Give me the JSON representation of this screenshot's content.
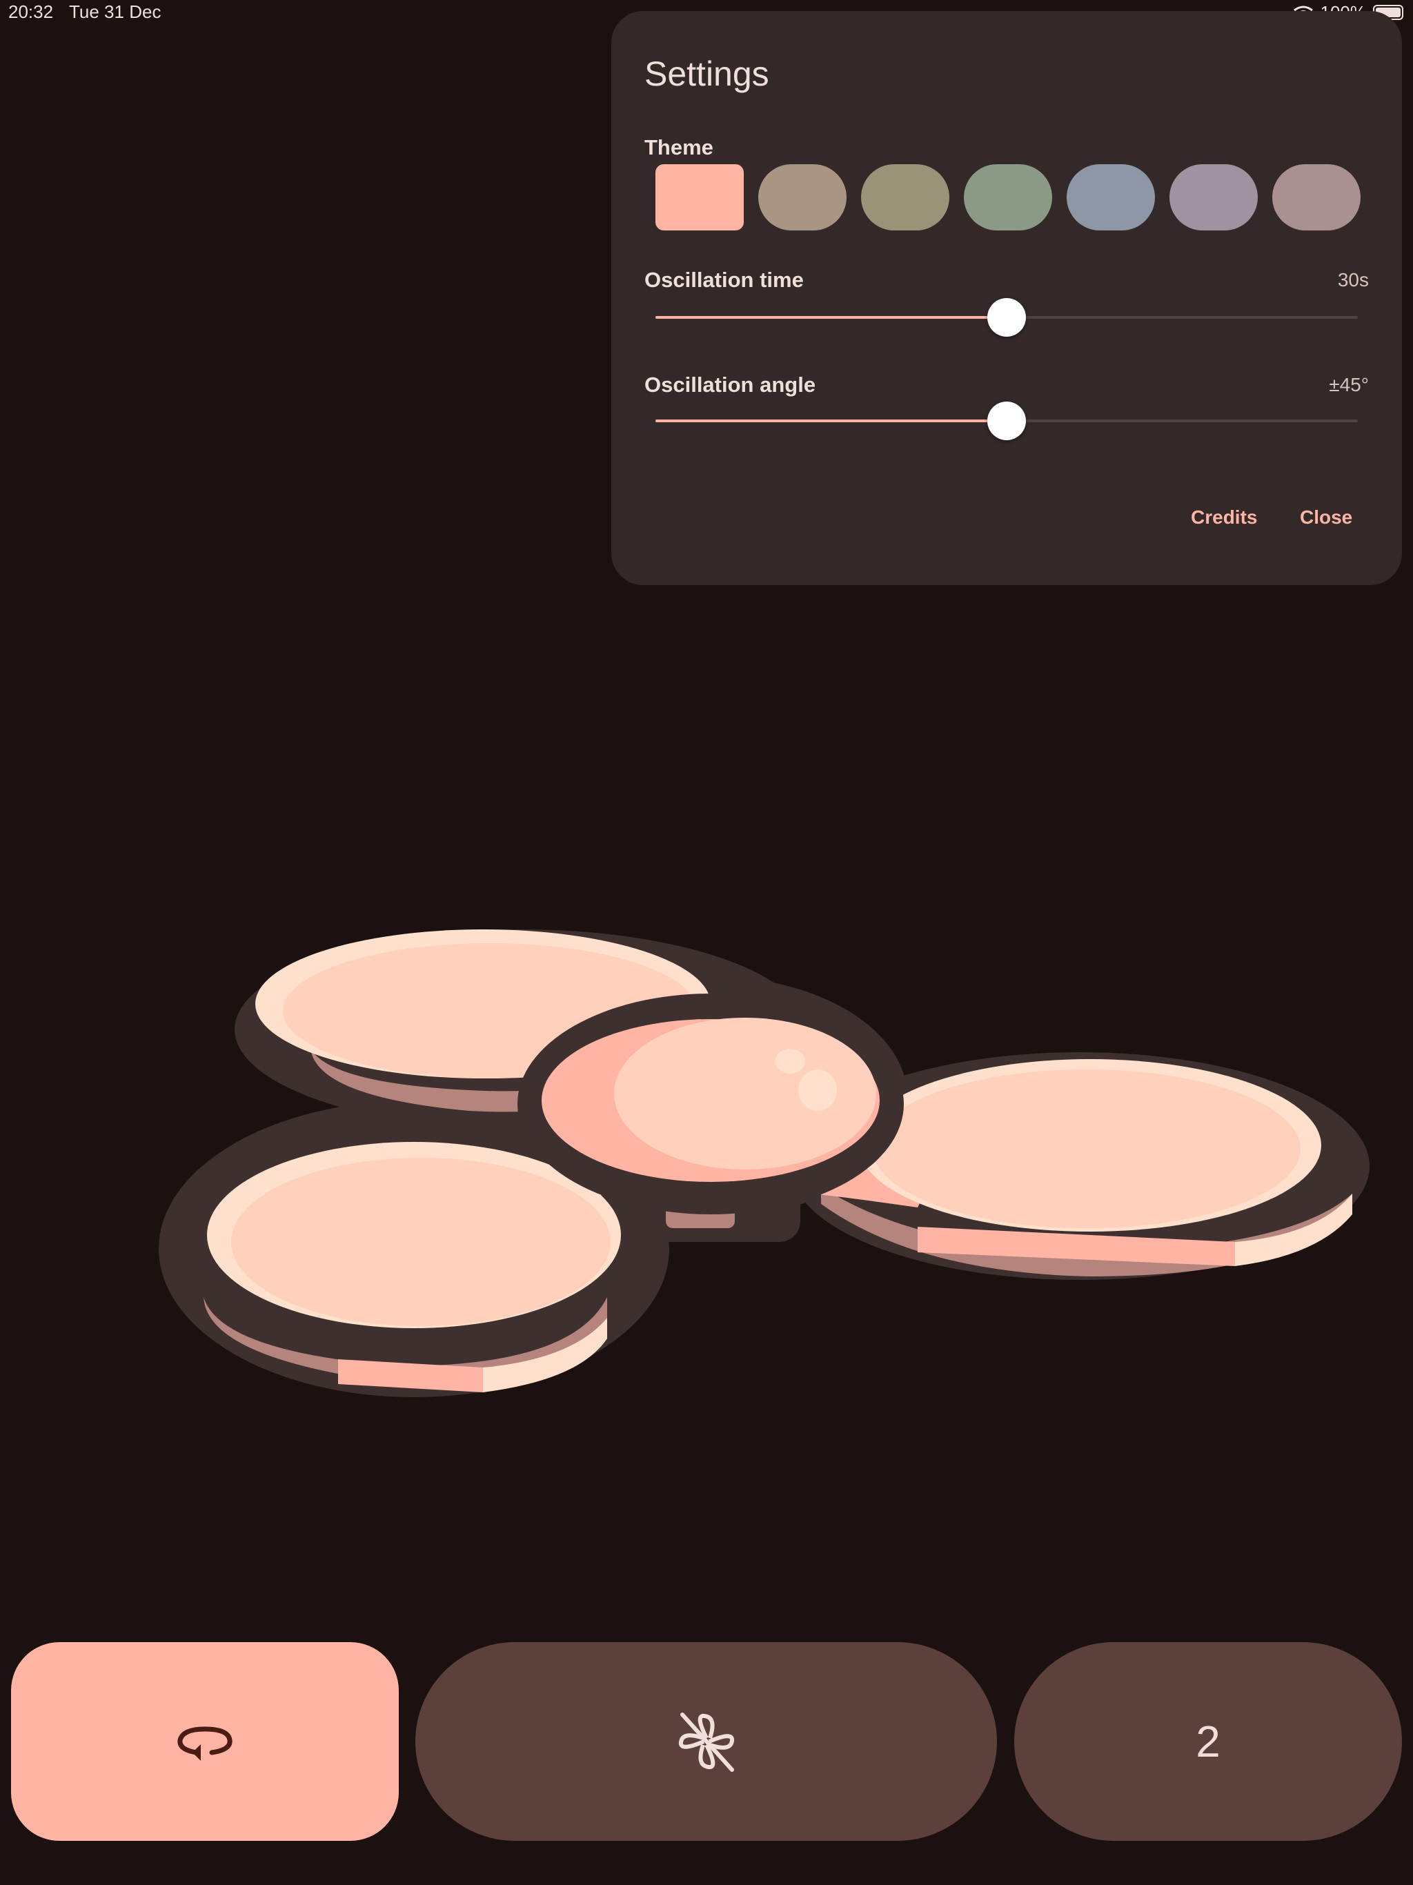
{
  "status_bar": {
    "time": "20:32",
    "date": "Tue 31 Dec",
    "battery": "100%"
  },
  "settings": {
    "title": "Settings",
    "theme_label": "Theme",
    "theme_colors": [
      "#ffb4a4",
      "#a99581",
      "#9a9377",
      "#8a9a86",
      "#8d97a6",
      "#a092a0",
      "#ab9091"
    ],
    "selected_theme_index": 0,
    "oscillation_time": {
      "label": "Oscillation time",
      "value": "30s",
      "level": 0.5
    },
    "oscillation_angle": {
      "label": "Oscillation angle",
      "value": "±45°",
      "level": 0.5
    },
    "credits_label": "Credits",
    "close_label": "Close"
  },
  "bottom_bar": {
    "rotate_icon": "rotate-icon",
    "fan_icon": "fan-off-icon",
    "count_label": "2"
  },
  "colors": {
    "accent": "#ffb4a4",
    "background": "#1a1110",
    "dialog": "#332928",
    "tonal_button": "#5c403b"
  }
}
